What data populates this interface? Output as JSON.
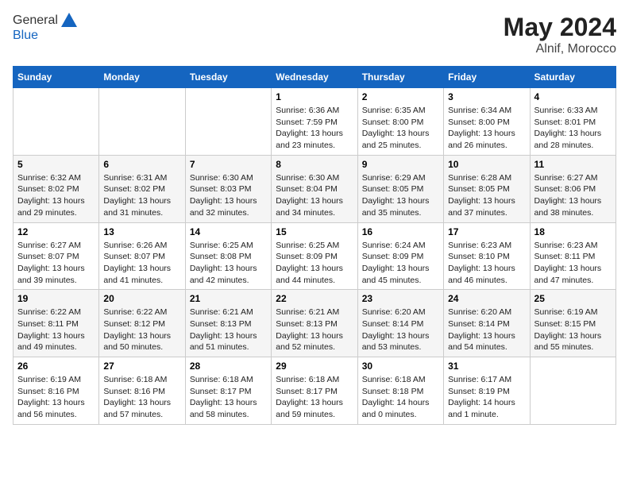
{
  "logo": {
    "general": "General",
    "blue": "Blue"
  },
  "title": {
    "month": "May 2024",
    "location": "Alnif, Morocco"
  },
  "weekdays": [
    "Sunday",
    "Monday",
    "Tuesday",
    "Wednesday",
    "Thursday",
    "Friday",
    "Saturday"
  ],
  "weeks": [
    [
      {
        "day": "",
        "content": ""
      },
      {
        "day": "",
        "content": ""
      },
      {
        "day": "",
        "content": ""
      },
      {
        "day": "1",
        "content": "Sunrise: 6:36 AM\nSunset: 7:59 PM\nDaylight: 13 hours\nand 23 minutes."
      },
      {
        "day": "2",
        "content": "Sunrise: 6:35 AM\nSunset: 8:00 PM\nDaylight: 13 hours\nand 25 minutes."
      },
      {
        "day": "3",
        "content": "Sunrise: 6:34 AM\nSunset: 8:00 PM\nDaylight: 13 hours\nand 26 minutes."
      },
      {
        "day": "4",
        "content": "Sunrise: 6:33 AM\nSunset: 8:01 PM\nDaylight: 13 hours\nand 28 minutes."
      }
    ],
    [
      {
        "day": "5",
        "content": "Sunrise: 6:32 AM\nSunset: 8:02 PM\nDaylight: 13 hours\nand 29 minutes."
      },
      {
        "day": "6",
        "content": "Sunrise: 6:31 AM\nSunset: 8:02 PM\nDaylight: 13 hours\nand 31 minutes."
      },
      {
        "day": "7",
        "content": "Sunrise: 6:30 AM\nSunset: 8:03 PM\nDaylight: 13 hours\nand 32 minutes."
      },
      {
        "day": "8",
        "content": "Sunrise: 6:30 AM\nSunset: 8:04 PM\nDaylight: 13 hours\nand 34 minutes."
      },
      {
        "day": "9",
        "content": "Sunrise: 6:29 AM\nSunset: 8:05 PM\nDaylight: 13 hours\nand 35 minutes."
      },
      {
        "day": "10",
        "content": "Sunrise: 6:28 AM\nSunset: 8:05 PM\nDaylight: 13 hours\nand 37 minutes."
      },
      {
        "day": "11",
        "content": "Sunrise: 6:27 AM\nSunset: 8:06 PM\nDaylight: 13 hours\nand 38 minutes."
      }
    ],
    [
      {
        "day": "12",
        "content": "Sunrise: 6:27 AM\nSunset: 8:07 PM\nDaylight: 13 hours\nand 39 minutes."
      },
      {
        "day": "13",
        "content": "Sunrise: 6:26 AM\nSunset: 8:07 PM\nDaylight: 13 hours\nand 41 minutes."
      },
      {
        "day": "14",
        "content": "Sunrise: 6:25 AM\nSunset: 8:08 PM\nDaylight: 13 hours\nand 42 minutes."
      },
      {
        "day": "15",
        "content": "Sunrise: 6:25 AM\nSunset: 8:09 PM\nDaylight: 13 hours\nand 44 minutes."
      },
      {
        "day": "16",
        "content": "Sunrise: 6:24 AM\nSunset: 8:09 PM\nDaylight: 13 hours\nand 45 minutes."
      },
      {
        "day": "17",
        "content": "Sunrise: 6:23 AM\nSunset: 8:10 PM\nDaylight: 13 hours\nand 46 minutes."
      },
      {
        "day": "18",
        "content": "Sunrise: 6:23 AM\nSunset: 8:11 PM\nDaylight: 13 hours\nand 47 minutes."
      }
    ],
    [
      {
        "day": "19",
        "content": "Sunrise: 6:22 AM\nSunset: 8:11 PM\nDaylight: 13 hours\nand 49 minutes."
      },
      {
        "day": "20",
        "content": "Sunrise: 6:22 AM\nSunset: 8:12 PM\nDaylight: 13 hours\nand 50 minutes."
      },
      {
        "day": "21",
        "content": "Sunrise: 6:21 AM\nSunset: 8:13 PM\nDaylight: 13 hours\nand 51 minutes."
      },
      {
        "day": "22",
        "content": "Sunrise: 6:21 AM\nSunset: 8:13 PM\nDaylight: 13 hours\nand 52 minutes."
      },
      {
        "day": "23",
        "content": "Sunrise: 6:20 AM\nSunset: 8:14 PM\nDaylight: 13 hours\nand 53 minutes."
      },
      {
        "day": "24",
        "content": "Sunrise: 6:20 AM\nSunset: 8:14 PM\nDaylight: 13 hours\nand 54 minutes."
      },
      {
        "day": "25",
        "content": "Sunrise: 6:19 AM\nSunset: 8:15 PM\nDaylight: 13 hours\nand 55 minutes."
      }
    ],
    [
      {
        "day": "26",
        "content": "Sunrise: 6:19 AM\nSunset: 8:16 PM\nDaylight: 13 hours\nand 56 minutes."
      },
      {
        "day": "27",
        "content": "Sunrise: 6:18 AM\nSunset: 8:16 PM\nDaylight: 13 hours\nand 57 minutes."
      },
      {
        "day": "28",
        "content": "Sunrise: 6:18 AM\nSunset: 8:17 PM\nDaylight: 13 hours\nand 58 minutes."
      },
      {
        "day": "29",
        "content": "Sunrise: 6:18 AM\nSunset: 8:17 PM\nDaylight: 13 hours\nand 59 minutes."
      },
      {
        "day": "30",
        "content": "Sunrise: 6:18 AM\nSunset: 8:18 PM\nDaylight: 14 hours\nand 0 minutes."
      },
      {
        "day": "31",
        "content": "Sunrise: 6:17 AM\nSunset: 8:19 PM\nDaylight: 14 hours\nand 1 minute."
      },
      {
        "day": "",
        "content": ""
      }
    ]
  ]
}
